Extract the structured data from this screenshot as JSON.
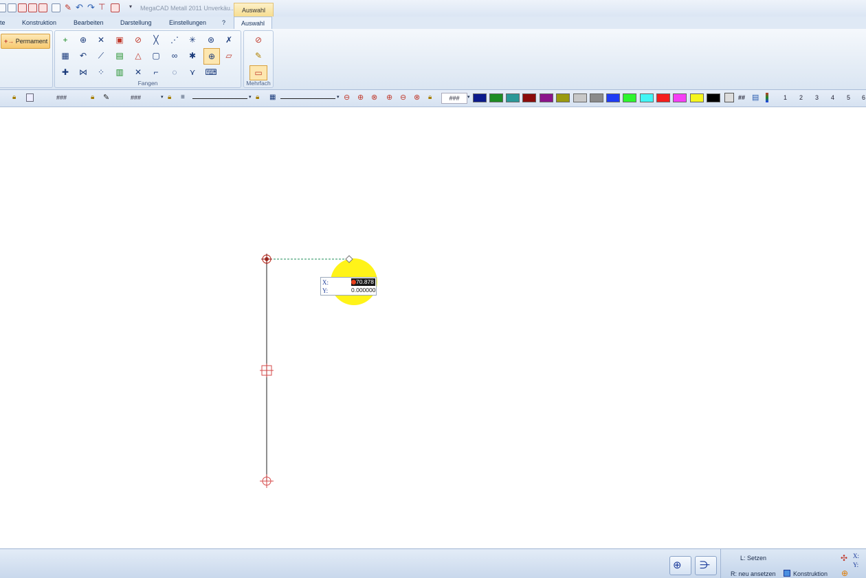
{
  "window": {
    "title": "MegaCAD Metall 2011  Unverkäu...",
    "context_tab_title": "Auswahl"
  },
  "ribbon_tabs": [
    {
      "label": "te"
    },
    {
      "label": "Konstruktion"
    },
    {
      "label": "Bearbeiten"
    },
    {
      "label": "Darstellung"
    },
    {
      "label": "Einstellungen"
    },
    {
      "label": "?"
    },
    {
      "label": "Auswahl",
      "active": true
    }
  ],
  "ribbon": {
    "permament_label": "Permament",
    "fangen_label": "Fangen",
    "mehrfach_label": "Mehrfach"
  },
  "properties_toolbar": {
    "placeholders": [
      "###",
      "###",
      "###"
    ],
    "grid_label": "##",
    "layer_numbers": [
      "1",
      "2",
      "3",
      "4",
      "5",
      "6"
    ],
    "colors": [
      "#0b1a8c",
      "#1e8c23",
      "#2a9898",
      "#8b0c0c",
      "#8b148b",
      "#9a9a10",
      "#c8c8c8",
      "#8a8a8a",
      "#1f3cf5",
      "#2ef52e",
      "#40f5f5",
      "#f51e1e",
      "#f53ef5",
      "#f5f51e",
      "#000000"
    ]
  },
  "coordinate_input": {
    "x_label": "X:",
    "y_label": "Y:",
    "x_value": "70.878",
    "y_value": "0.000000"
  },
  "statusbar": {
    "left_hint": "L: Setzen",
    "right_hint": "R: neu ansetzen",
    "mode": "Konstruktion",
    "x_label": "X:",
    "y_label": "Y:"
  },
  "colors": {
    "highlight": "#fff200",
    "accent": "#f7c970",
    "construction": "#c0392b"
  }
}
